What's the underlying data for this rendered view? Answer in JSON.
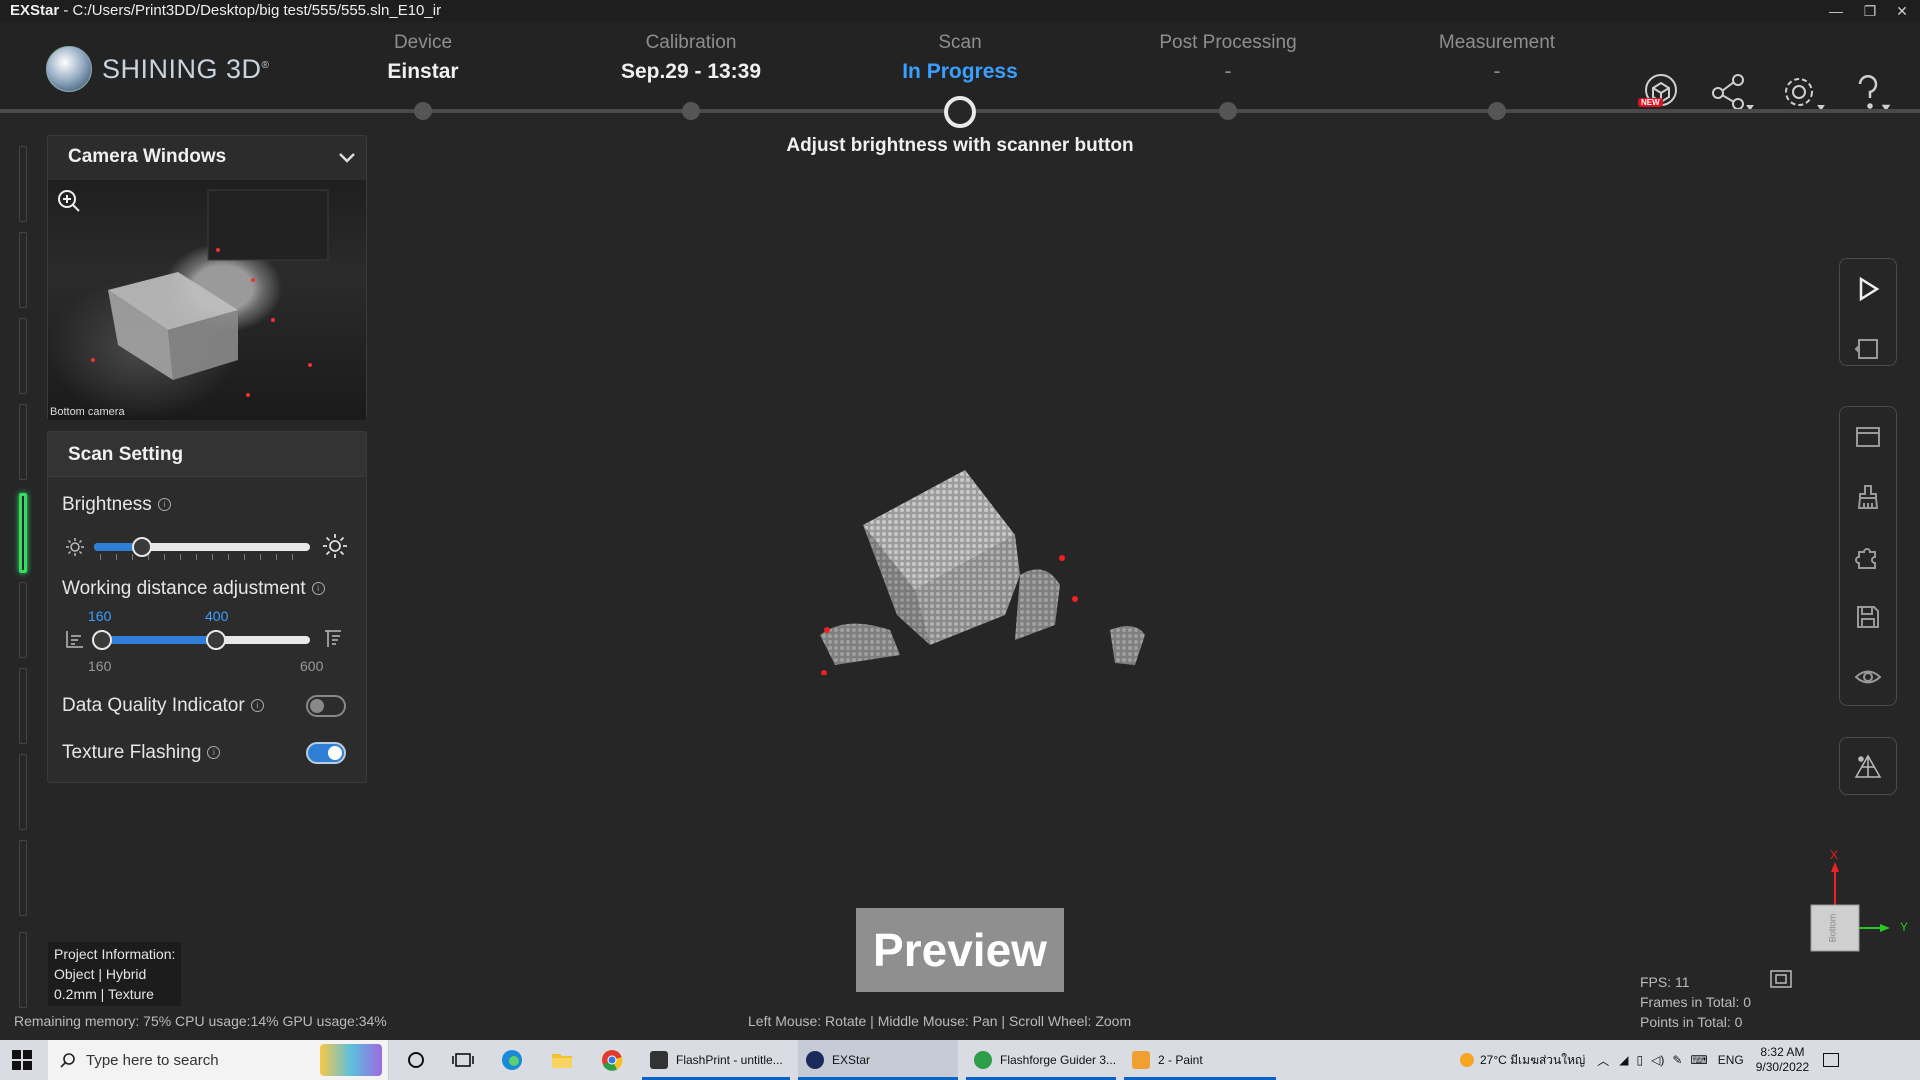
{
  "titlebar": {
    "app": "EXStar",
    "separator": " - ",
    "path": "C:/Users/Print3DD/Desktop/big test/555/555.sln_E10_ir"
  },
  "header": {
    "brand": "SHINING 3D",
    "brand_mark": "®",
    "steps": [
      {
        "label": "Device",
        "value": "Einstar"
      },
      {
        "label": "Calibration",
        "value": "Sep.29 - 13:39"
      },
      {
        "label": "Scan",
        "value": "In Progress"
      },
      {
        "label": "Post Processing",
        "value": "-"
      },
      {
        "label": "Measurement",
        "value": "-"
      }
    ],
    "new_badge": "NEW",
    "hint": "Adjust brightness with scanner button"
  },
  "camera": {
    "title": "Camera Windows",
    "label": "Bottom camera"
  },
  "scan_setting": {
    "title": "Scan Setting",
    "brightness": {
      "label": "Brightness",
      "value_fraction": 0.22
    },
    "working_distance": {
      "label": "Working distance adjustment",
      "low": "160",
      "high": "400",
      "min": "160",
      "max": "600"
    },
    "data_quality": {
      "label": "Data Quality Indicator",
      "on": false
    },
    "texture_flashing": {
      "label": "Texture Flashing",
      "on": true
    }
  },
  "viewport": {
    "preview": "Preview",
    "project_info": {
      "title": "Project Information:",
      "line1": "Object | Hybrid",
      "line2": "0.2mm | Texture"
    },
    "status_left": "Remaining memory: 75% CPU usage:14%  GPU usage:34%",
    "mouse_hint": "Left Mouse: Rotate | Middle Mouse: Pan | Scroll Wheel: Zoom",
    "fps": "FPS: 11",
    "frames": "Frames in Total: 0",
    "points": "Points in Total: 0",
    "axis_x": "X",
    "axis_y": "Y",
    "cube_face": "Bottom"
  },
  "taskbar": {
    "search_placeholder": "Type here to search",
    "apps": [
      {
        "label": "FlashPrint - untitle..."
      },
      {
        "label": "EXStar"
      },
      {
        "label": "Flashforge Guider 3..."
      },
      {
        "label": "2 - Paint"
      }
    ],
    "weather": "27°C  มีเมฆส่วนใหญ่",
    "lang": "ENG",
    "time": "8:32 AM",
    "date": "9/30/2022"
  },
  "colors": {
    "accent": "#2f7fd6",
    "active_step": "#3aa0ff",
    "strip_active": "#33dd66"
  }
}
